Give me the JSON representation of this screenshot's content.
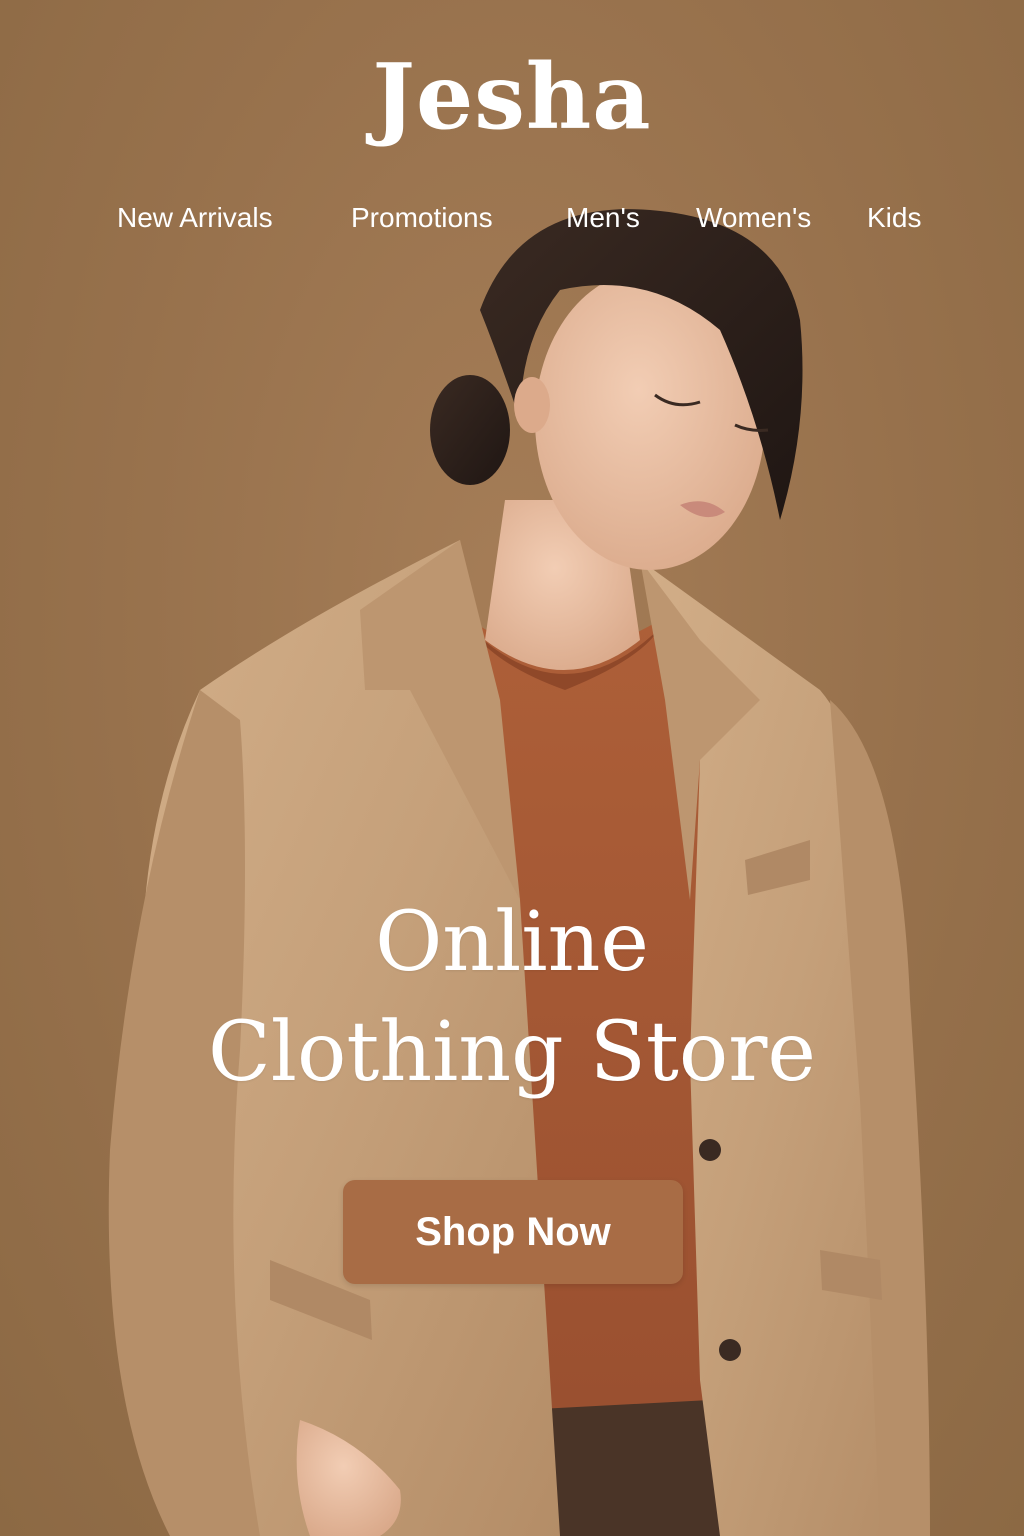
{
  "brand": {
    "name": "Jesha"
  },
  "nav": {
    "items": [
      {
        "label": "New Arrivals"
      },
      {
        "label": "Promotions"
      },
      {
        "label": "Men's"
      },
      {
        "label": "Women's"
      },
      {
        "label": "Kids"
      }
    ]
  },
  "hero": {
    "title_line1": "Online",
    "title_line2": "Clothing Store",
    "cta_label": "Shop Now",
    "image_description": "Woman in camel wool blazer over rust knit sweater",
    "colors": {
      "background": "#9a7450",
      "button": "#a86c45",
      "text": "#ffffff",
      "coat": "#c9a37c",
      "sweater": "#a55a35"
    }
  }
}
